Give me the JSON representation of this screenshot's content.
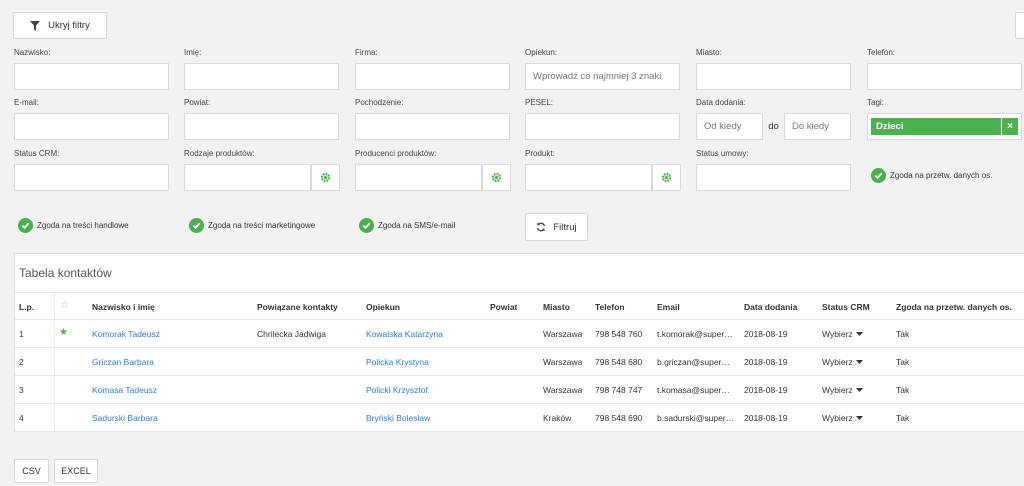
{
  "toolbar": {
    "hide_filters_label": "Ukryj filtry"
  },
  "filters": {
    "row1": [
      {
        "label": "Nazwisko:",
        "value": ""
      },
      {
        "label": "Imię:",
        "value": ""
      },
      {
        "label": "Firma:",
        "value": ""
      },
      {
        "label": "Opiekun:",
        "value": "Wprowadź co najmniej 3 znaki"
      },
      {
        "label": "Miasto:",
        "value": ""
      },
      {
        "label": "Telefon:",
        "value": ""
      }
    ],
    "row2": [
      {
        "label": "E-mail:",
        "value": ""
      },
      {
        "label": "Powiat:",
        "value": ""
      },
      {
        "label": "Pochodzenie:",
        "value": ""
      },
      {
        "label": "PESEL:",
        "value": ""
      }
    ],
    "date": {
      "label": "Data dodania:",
      "from_placeholder": "Od kiedy",
      "sep": "do",
      "to_placeholder": "Do kiedy"
    },
    "tags": {
      "label": "Tagi:",
      "tag": "Dzieci",
      "remove": "×",
      "color": "#4caf50"
    },
    "row3": [
      {
        "label": "Status CRM:"
      },
      {
        "label": "Rodzaje produktów:"
      },
      {
        "label": "Producenci produktów:"
      },
      {
        "label": "Produkt:"
      },
      {
        "label": "Status umowy:"
      }
    ],
    "consents": {
      "data_processing": "Zgoda na przetw. danych os.",
      "commercial": "Zgoda na treści handlowe",
      "marketing": "Zgoda na treści marketingowe",
      "sms": "Zgoda na SMS/e-mail"
    },
    "filter_button": "Filtruj"
  },
  "table": {
    "title": "Tabela kontaktów",
    "headers": {
      "lp": "L.p.",
      "star": "☆",
      "name": "Nazwisko i imię",
      "related": "Powiązane kontakty",
      "guardian": "Opiekun",
      "county": "Powiat",
      "city": "Miasto",
      "phone": "Telefon",
      "email": "Email",
      "date": "Data dodania",
      "crm": "Status CRM",
      "consent": "Zgoda na przetw. danych os."
    },
    "rows": [
      {
        "lp": "1",
        "star": "★",
        "name": "Komorak Tadeusz",
        "related": "Chrilecka Jadwiga",
        "guardian": "Kowalska Katarzyna",
        "county": "",
        "city": "Warszawa",
        "phone": "798 548 760",
        "email": "t.komorak@super…",
        "date": "2018-08-19",
        "crm": "Wybierz",
        "consent": "Tak"
      },
      {
        "lp": "2",
        "star": "",
        "name": "Griczan Barbara",
        "related": "",
        "guardian": "Policka Krystyna",
        "county": "",
        "city": "Warszawa",
        "phone": "798 548 680",
        "email": "b.griczan@super…",
        "date": "2018-08-19",
        "crm": "Wybierz",
        "consent": "Tak"
      },
      {
        "lp": "3",
        "star": "",
        "name": "Komasa Tadeusz",
        "related": "",
        "guardian": "Policki Krzysztof",
        "county": "",
        "city": "Warszawa",
        "phone": "798 748 747",
        "email": "t.komasa@super…",
        "date": "2018-08-19",
        "crm": "Wybierz",
        "consent": "Tak"
      },
      {
        "lp": "4",
        "star": "",
        "name": "Sadurski Barbara",
        "related": "",
        "guardian": "Bryński Bolesław",
        "county": "",
        "city": "Kraków",
        "phone": "798 548 690",
        "email": "b.sadurski@super…",
        "date": "2018-08-19",
        "crm": "Wybierz",
        "consent": "Tak"
      }
    ]
  },
  "export": {
    "csv": "CSV",
    "excel": "EXCEL"
  },
  "colors": {
    "accent": "#4caf50",
    "link": "#2f7fc4"
  }
}
